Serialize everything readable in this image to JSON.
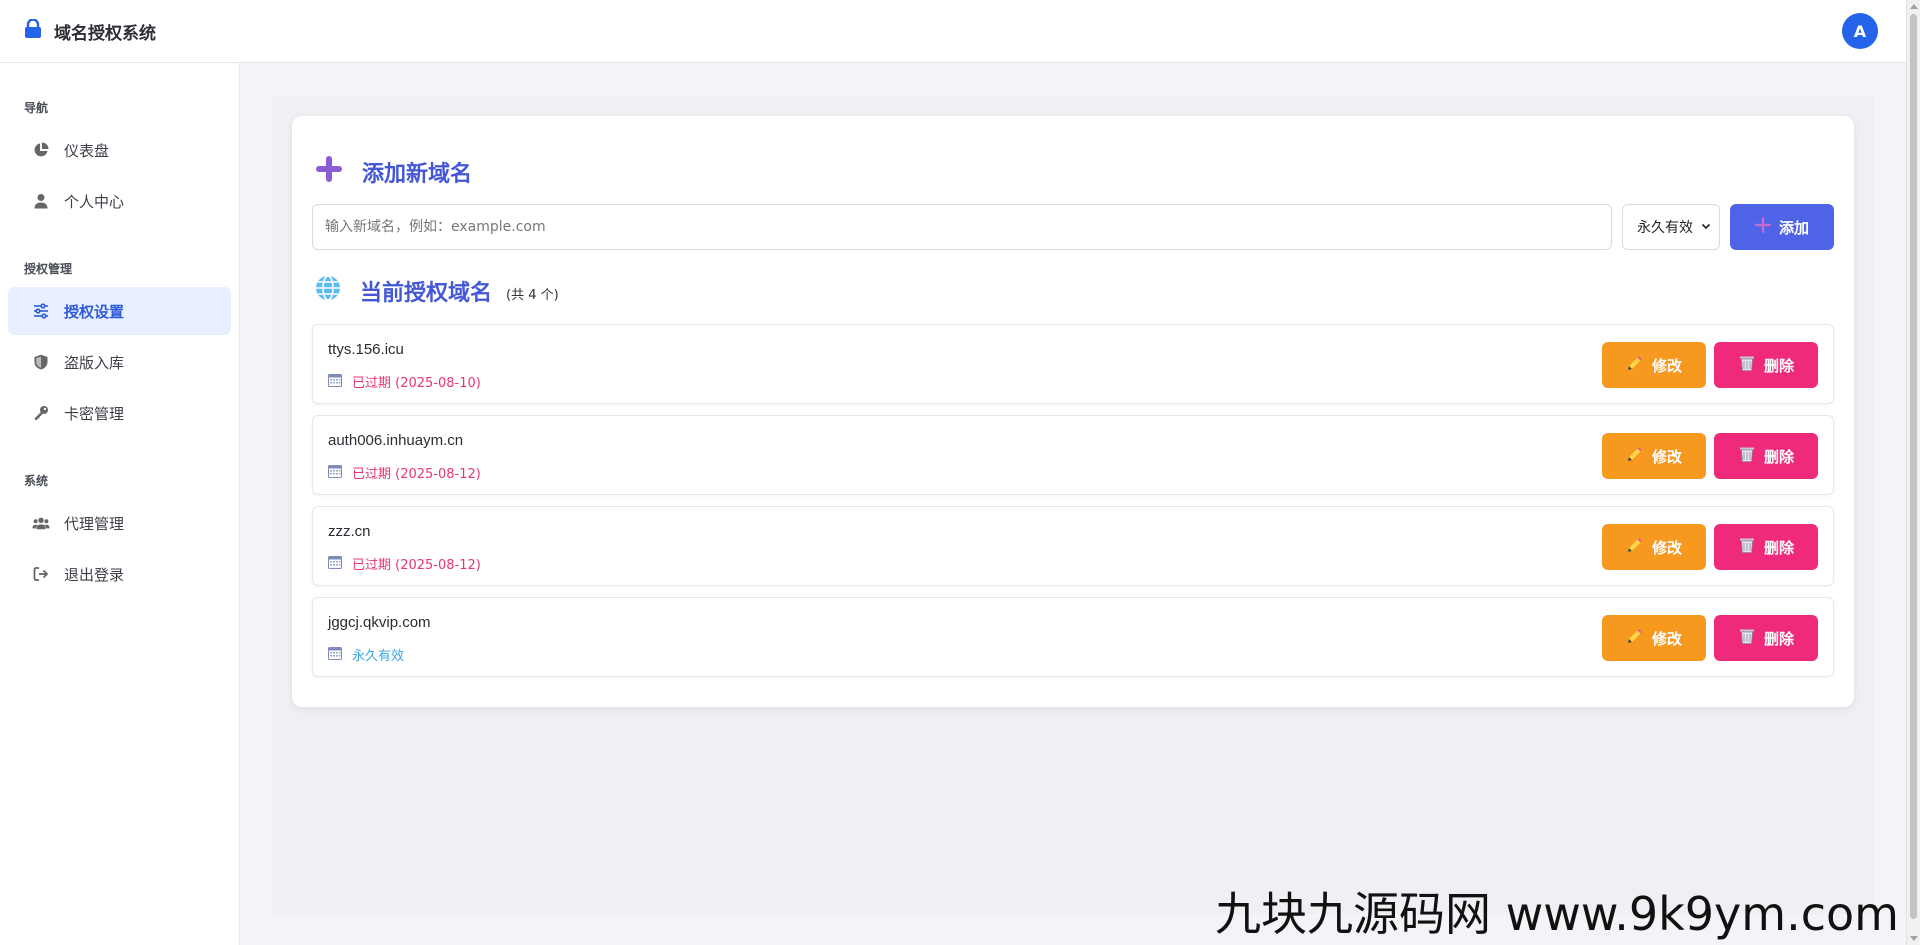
{
  "header": {
    "brand_title": "域名授权系统",
    "avatar_letter": "A",
    "accent": "#2563eb"
  },
  "sidebar": {
    "sections": [
      {
        "title": "导航",
        "items": [
          {
            "label": "仪表盘",
            "icon": "pie-chart-icon"
          },
          {
            "label": "个人中心",
            "icon": "user-icon"
          }
        ]
      },
      {
        "title": "授权管理",
        "items": [
          {
            "label": "授权设置",
            "icon": "sliders-icon",
            "active": true
          },
          {
            "label": "盗版入库",
            "icon": "shield-icon"
          },
          {
            "label": "卡密管理",
            "icon": "key-icon"
          }
        ]
      },
      {
        "title": "系统",
        "items": [
          {
            "label": "代理管理",
            "icon": "users-icon"
          },
          {
            "label": "退出登录",
            "icon": "logout-icon"
          }
        ]
      }
    ]
  },
  "add_section": {
    "title": "添加新域名",
    "input_placeholder": "输入新域名，例如：example.com",
    "input_value": "",
    "duration_selected": "永久有效",
    "add_button": "添加"
  },
  "list_section": {
    "title": "当前授权域名",
    "count": "(共 4 个)"
  },
  "domains": [
    {
      "name": "ttys.156.icu",
      "status": "已过期 (2025-08-10)",
      "status_type": "expired"
    },
    {
      "name": "auth006.inhuaym.cn",
      "status": "已过期 (2025-08-12)",
      "status_type": "expired"
    },
    {
      "name": "zzz.cn",
      "status": "已过期 (2025-08-12)",
      "status_type": "expired"
    },
    {
      "name": "jggcj.qkvip.com",
      "status": "永久有效",
      "status_type": "forever"
    }
  ],
  "actions": {
    "edit": "修改",
    "delete": "删除"
  },
  "colors": {
    "expired": "#e8356f",
    "forever": "#3aa8e8",
    "edit": "#f7981f",
    "delete": "#f02a7b",
    "add": "#4f63e6",
    "title": "#4457d6"
  },
  "watermark": "九块九源码网 www.9k9ym.com"
}
